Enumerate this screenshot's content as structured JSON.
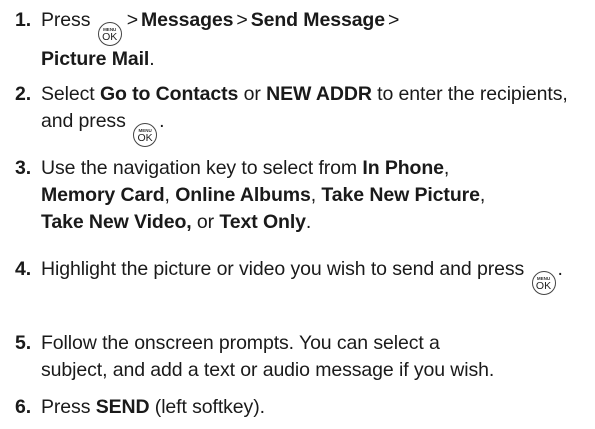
{
  "key_icon": {
    "top_label": "MENU",
    "bottom_label": "OK"
  },
  "steps": [
    {
      "number": "1.",
      "press": "Press",
      "sep": ">",
      "messages": "Messages",
      "send_message": "Send Message",
      "picture_mail": "Picture Mail",
      "period": "."
    },
    {
      "number": "2.",
      "select": "Select",
      "go_to_contacts": "Go to Contacts",
      "or": "or",
      "new_addr": "NEW ADDR",
      "rest": "to enter the recipients, and press",
      "period": "."
    },
    {
      "number": "3.",
      "intro": "Use the navigation key to select from",
      "in_phone": "In Phone",
      "comma": ",",
      "memory_card": "Memory Card",
      "online_albums": "Online Albums",
      "take_new_picture": "Take New Picture",
      "take_new_video": "Take New Video,",
      "or": "or",
      "text_only": "Text Only",
      "period": "."
    },
    {
      "number": "4.",
      "text": "Highlight the picture or video you wish to send and press",
      "period": "."
    },
    {
      "number": "5.",
      "line1": "Follow the onscreen prompts. You can select a",
      "line2": "subject, and add a text or audio message if you wish."
    },
    {
      "number": "6.",
      "press": "Press",
      "send": "SEND",
      "rest": "(left softkey)."
    }
  ]
}
